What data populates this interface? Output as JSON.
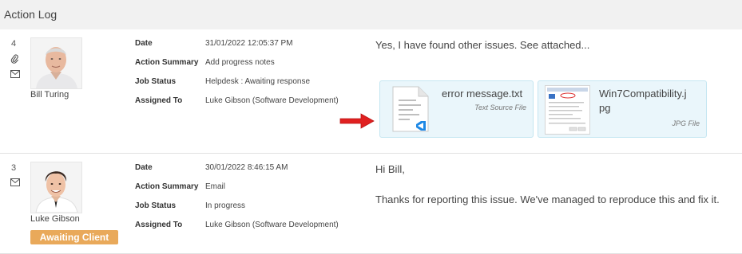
{
  "panel": {
    "title": "Action Log"
  },
  "entries": [
    {
      "number": "4",
      "author": "Bill Turing",
      "fields": [
        {
          "label": "Date",
          "value": "31/01/2022 12:05:37 PM"
        },
        {
          "label": "Action Summary",
          "value": "Add progress notes"
        },
        {
          "label": "Job Status",
          "value": "Helpdesk : Awaiting response"
        },
        {
          "label": "Assigned To",
          "value": "Luke Gibson (Software Development)"
        }
      ],
      "message": [
        "Yes, I have found other issues.  See attached..."
      ],
      "attachments": [
        {
          "name": "error message.txt",
          "type": "Text Source File",
          "icon": "vscode-text-file-icon"
        },
        {
          "name_line1": "Win7Compatibility.j",
          "name_line2": "pg",
          "type": "JPG File",
          "icon": "image-thumbnail"
        }
      ]
    },
    {
      "number": "3",
      "author": "Luke Gibson",
      "badge": "Awaiting Client",
      "fields": [
        {
          "label": "Date",
          "value": "30/01/2022 8:46:15 AM"
        },
        {
          "label": "Action Summary",
          "value": "Email"
        },
        {
          "label": "Job Status",
          "value": "In progress"
        },
        {
          "label": "Assigned To",
          "value": "Luke Gibson (Software Development)"
        }
      ],
      "message": [
        "Hi Bill,",
        "Thanks for reporting this issue.  We've managed to reproduce this and fix it."
      ]
    }
  ],
  "colors": {
    "badge": "#e9a95a",
    "attachment_bg": "#eaf6fb",
    "attachment_border": "#c4e6f1",
    "arrow": "#e02020"
  }
}
